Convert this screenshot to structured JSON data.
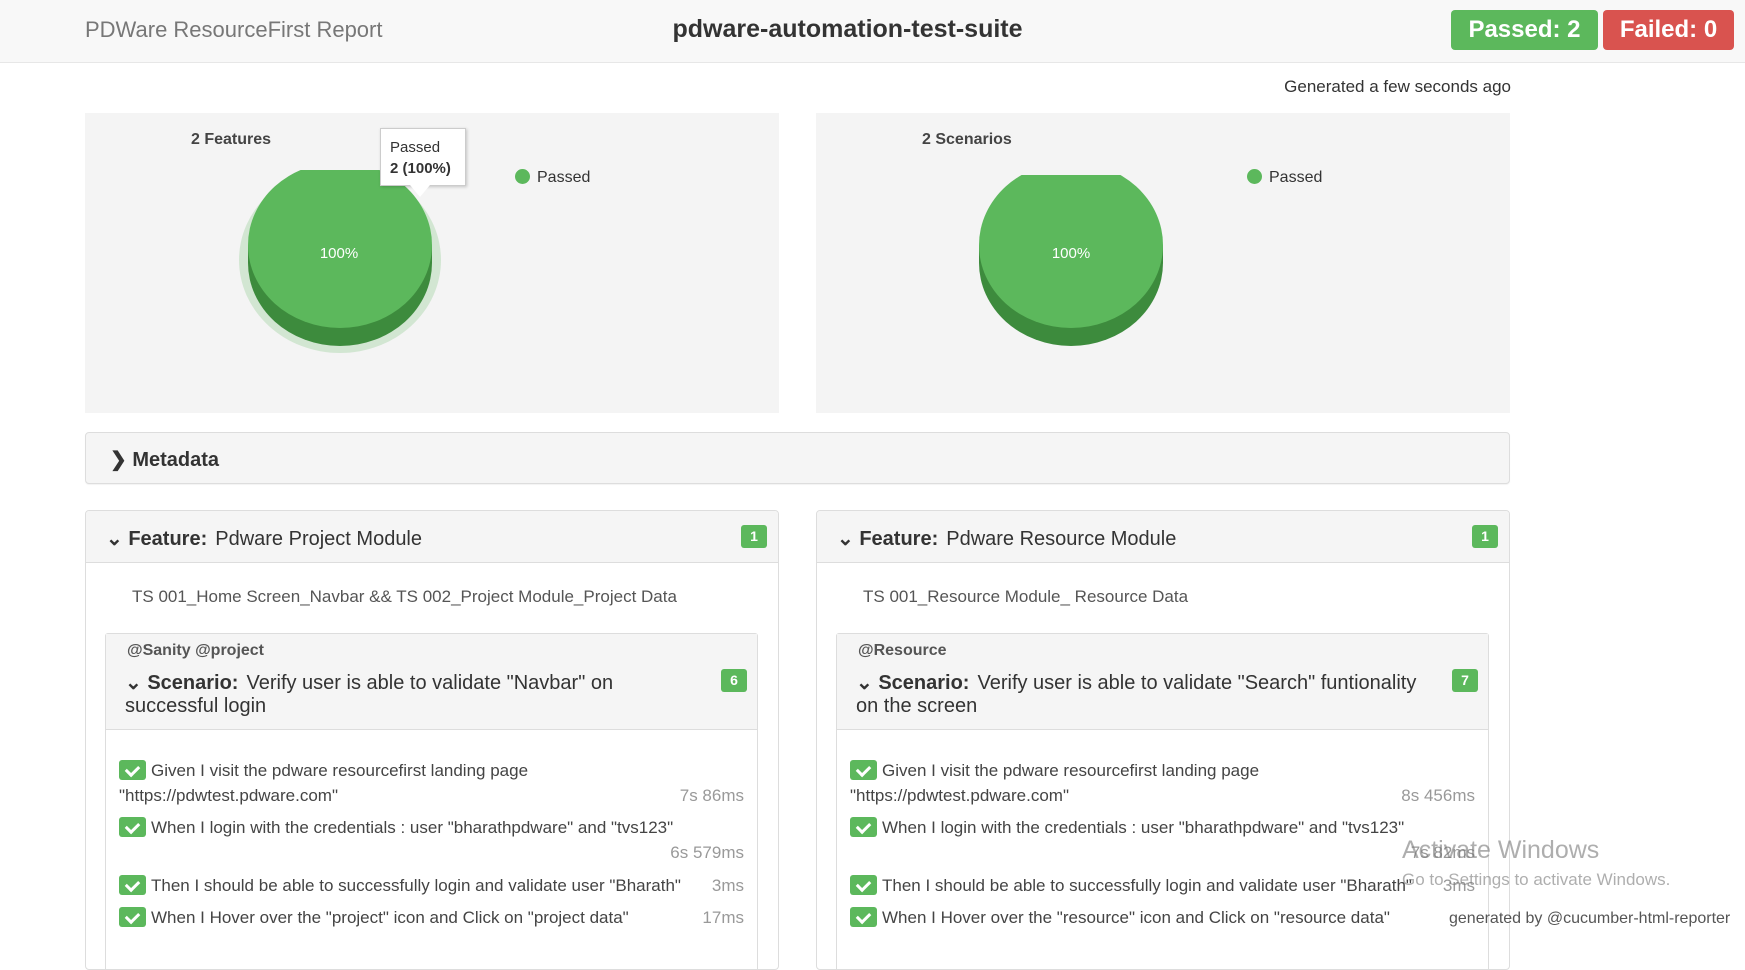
{
  "header": {
    "brand": "PDWare ResourceFirst Report",
    "suite_name": "pdware-automation-test-suite",
    "passed_label": "Passed: 2",
    "failed_label": "Failed: 0"
  },
  "generated": "Generated a few seconds ago",
  "charts": [
    {
      "title": "2 Features",
      "legend": "Passed",
      "slice_label": "100%",
      "tooltip_label": "Passed",
      "tooltip_value": "2 (100%)"
    },
    {
      "title": "2 Scenarios",
      "legend": "Passed",
      "slice_label": "100%"
    }
  ],
  "chart_data": [
    {
      "type": "pie",
      "title": "2 Features",
      "categories": [
        "Passed"
      ],
      "values": [
        2
      ],
      "percent": [
        100
      ],
      "colors": [
        "#5cb85c"
      ],
      "legend": "top-right"
    },
    {
      "type": "pie",
      "title": "2 Scenarios",
      "categories": [
        "Passed"
      ],
      "values": [
        2
      ],
      "percent": [
        100
      ],
      "colors": [
        "#5cb85c"
      ],
      "legend": "top-right"
    }
  ],
  "metadata": {
    "label": "Metadata"
  },
  "features": [
    {
      "keyword": "Feature:",
      "name": "Pdware Project Module",
      "count": "1",
      "description": "TS 001_Home Screen_Navbar && TS 002_Project Module_Project Data",
      "scenario": {
        "tags": "@Sanity @project",
        "keyword": "Scenario:",
        "name": "Verify user is able to validate \"Navbar\" on successful login",
        "count": "6",
        "steps": [
          {
            "text": "Given I visit the pdware resourcefirst landing page \"https://pdwtest.pdware.com\"",
            "duration": "7s 86ms"
          },
          {
            "text": "When I login with the credentials : user \"bharathpdware\" and \"tvs123\"",
            "duration": "6s 579ms"
          },
          {
            "text": "Then I should be able to successfully login and validate user \"Bharath\"",
            "duration": "3ms"
          },
          {
            "text": "When I Hover over the \"project\" icon and Click on \"project data\"",
            "duration": "17ms"
          }
        ]
      }
    },
    {
      "keyword": "Feature:",
      "name": "Pdware Resource Module",
      "count": "1",
      "description": "TS 001_Resource Module_ Resource Data",
      "scenario": {
        "tags": "@Resource",
        "keyword": "Scenario:",
        "name": "Verify user is able to validate \"Search\" funtionality on the screen",
        "count": "7",
        "steps": [
          {
            "text": "Given I visit the pdware resourcefirst landing page \"https://pdwtest.pdware.com\"",
            "duration": "8s 456ms"
          },
          {
            "text": "When I login with the credentials : user \"bharathpdware\" and \"tvs123\"",
            "duration": "7s 82ms"
          },
          {
            "text": "Then I should be able to successfully login and validate user \"Bharath\"",
            "duration": "3ms"
          },
          {
            "text": "When I Hover over the \"resource\" icon and Click on \"resource data\"",
            "duration": ""
          }
        ]
      }
    }
  ],
  "watermark": {
    "title": "Activate Windows",
    "subtitle": "Go to Settings to activate Windows."
  },
  "footer": "generated by @cucumber-html-reporter"
}
